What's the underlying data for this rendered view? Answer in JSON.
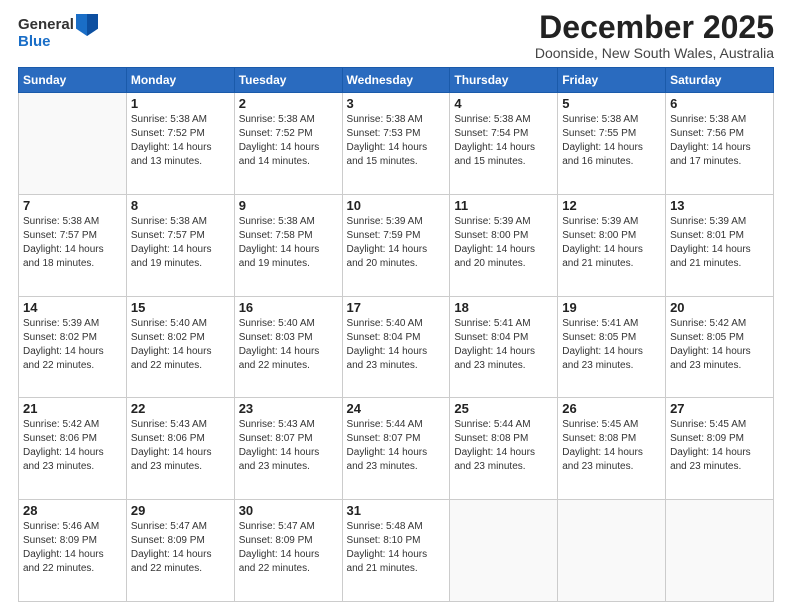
{
  "app": {
    "logo_line1": "General",
    "logo_line2": "Blue"
  },
  "header": {
    "month_title": "December 2025",
    "location": "Doonside, New South Wales, Australia"
  },
  "days_of_week": [
    "Sunday",
    "Monday",
    "Tuesday",
    "Wednesday",
    "Thursday",
    "Friday",
    "Saturday"
  ],
  "weeks": [
    [
      {
        "day": "",
        "content": ""
      },
      {
        "day": "1",
        "content": "Sunrise: 5:38 AM\nSunset: 7:52 PM\nDaylight: 14 hours\nand 13 minutes."
      },
      {
        "day": "2",
        "content": "Sunrise: 5:38 AM\nSunset: 7:52 PM\nDaylight: 14 hours\nand 14 minutes."
      },
      {
        "day": "3",
        "content": "Sunrise: 5:38 AM\nSunset: 7:53 PM\nDaylight: 14 hours\nand 15 minutes."
      },
      {
        "day": "4",
        "content": "Sunrise: 5:38 AM\nSunset: 7:54 PM\nDaylight: 14 hours\nand 15 minutes."
      },
      {
        "day": "5",
        "content": "Sunrise: 5:38 AM\nSunset: 7:55 PM\nDaylight: 14 hours\nand 16 minutes."
      },
      {
        "day": "6",
        "content": "Sunrise: 5:38 AM\nSunset: 7:56 PM\nDaylight: 14 hours\nand 17 minutes."
      }
    ],
    [
      {
        "day": "7",
        "content": "Sunrise: 5:38 AM\nSunset: 7:57 PM\nDaylight: 14 hours\nand 18 minutes."
      },
      {
        "day": "8",
        "content": "Sunrise: 5:38 AM\nSunset: 7:57 PM\nDaylight: 14 hours\nand 19 minutes."
      },
      {
        "day": "9",
        "content": "Sunrise: 5:38 AM\nSunset: 7:58 PM\nDaylight: 14 hours\nand 19 minutes."
      },
      {
        "day": "10",
        "content": "Sunrise: 5:39 AM\nSunset: 7:59 PM\nDaylight: 14 hours\nand 20 minutes."
      },
      {
        "day": "11",
        "content": "Sunrise: 5:39 AM\nSunset: 8:00 PM\nDaylight: 14 hours\nand 20 minutes."
      },
      {
        "day": "12",
        "content": "Sunrise: 5:39 AM\nSunset: 8:00 PM\nDaylight: 14 hours\nand 21 minutes."
      },
      {
        "day": "13",
        "content": "Sunrise: 5:39 AM\nSunset: 8:01 PM\nDaylight: 14 hours\nand 21 minutes."
      }
    ],
    [
      {
        "day": "14",
        "content": "Sunrise: 5:39 AM\nSunset: 8:02 PM\nDaylight: 14 hours\nand 22 minutes."
      },
      {
        "day": "15",
        "content": "Sunrise: 5:40 AM\nSunset: 8:02 PM\nDaylight: 14 hours\nand 22 minutes."
      },
      {
        "day": "16",
        "content": "Sunrise: 5:40 AM\nSunset: 8:03 PM\nDaylight: 14 hours\nand 22 minutes."
      },
      {
        "day": "17",
        "content": "Sunrise: 5:40 AM\nSunset: 8:04 PM\nDaylight: 14 hours\nand 23 minutes."
      },
      {
        "day": "18",
        "content": "Sunrise: 5:41 AM\nSunset: 8:04 PM\nDaylight: 14 hours\nand 23 minutes."
      },
      {
        "day": "19",
        "content": "Sunrise: 5:41 AM\nSunset: 8:05 PM\nDaylight: 14 hours\nand 23 minutes."
      },
      {
        "day": "20",
        "content": "Sunrise: 5:42 AM\nSunset: 8:05 PM\nDaylight: 14 hours\nand 23 minutes."
      }
    ],
    [
      {
        "day": "21",
        "content": "Sunrise: 5:42 AM\nSunset: 8:06 PM\nDaylight: 14 hours\nand 23 minutes."
      },
      {
        "day": "22",
        "content": "Sunrise: 5:43 AM\nSunset: 8:06 PM\nDaylight: 14 hours\nand 23 minutes."
      },
      {
        "day": "23",
        "content": "Sunrise: 5:43 AM\nSunset: 8:07 PM\nDaylight: 14 hours\nand 23 minutes."
      },
      {
        "day": "24",
        "content": "Sunrise: 5:44 AM\nSunset: 8:07 PM\nDaylight: 14 hours\nand 23 minutes."
      },
      {
        "day": "25",
        "content": "Sunrise: 5:44 AM\nSunset: 8:08 PM\nDaylight: 14 hours\nand 23 minutes."
      },
      {
        "day": "26",
        "content": "Sunrise: 5:45 AM\nSunset: 8:08 PM\nDaylight: 14 hours\nand 23 minutes."
      },
      {
        "day": "27",
        "content": "Sunrise: 5:45 AM\nSunset: 8:09 PM\nDaylight: 14 hours\nand 23 minutes."
      }
    ],
    [
      {
        "day": "28",
        "content": "Sunrise: 5:46 AM\nSunset: 8:09 PM\nDaylight: 14 hours\nand 22 minutes."
      },
      {
        "day": "29",
        "content": "Sunrise: 5:47 AM\nSunset: 8:09 PM\nDaylight: 14 hours\nand 22 minutes."
      },
      {
        "day": "30",
        "content": "Sunrise: 5:47 AM\nSunset: 8:09 PM\nDaylight: 14 hours\nand 22 minutes."
      },
      {
        "day": "31",
        "content": "Sunrise: 5:48 AM\nSunset: 8:10 PM\nDaylight: 14 hours\nand 21 minutes."
      },
      {
        "day": "",
        "content": ""
      },
      {
        "day": "",
        "content": ""
      },
      {
        "day": "",
        "content": ""
      }
    ]
  ]
}
